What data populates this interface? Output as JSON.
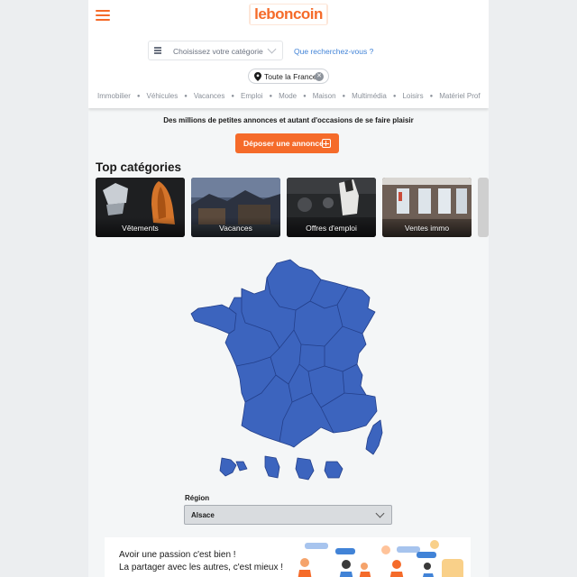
{
  "header": {
    "logo": "leboncoin",
    "category_placeholder": "Choisissez votre catégorie",
    "search_placeholder": "Que recherchez-vous ?",
    "location": "Toute la France"
  },
  "nav": {
    "items": [
      "Immobilier",
      "Véhicules",
      "Vacances",
      "Emploi",
      "Mode",
      "Maison",
      "Multimédia",
      "Loisirs",
      "Matériel Prof"
    ]
  },
  "hero": {
    "tagline": "Des millions de petites annonces et autant d'occasions de se faire plaisir",
    "deposit_label": "Déposer une annonce"
  },
  "top_categories": {
    "title": "Top catégories",
    "items": [
      "Vêtements",
      "Vacances",
      "Offres d'emploi",
      "Ventes immo"
    ]
  },
  "region": {
    "label": "Région",
    "selected": "Alsace"
  },
  "promo": {
    "line1": "Avoir une passion c'est bien !",
    "line2": "La partager avec les autres, c'est mieux !"
  },
  "colors": {
    "brand": "#f56b2a",
    "map": "#3c64be",
    "link": "#4183d7"
  }
}
